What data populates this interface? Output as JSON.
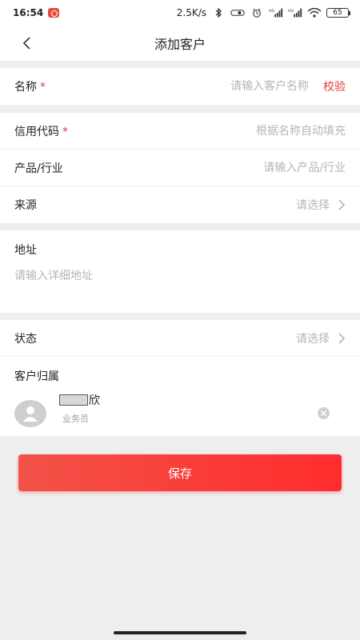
{
  "status_bar": {
    "time": "16:54",
    "network_speed": "2.5K/s",
    "battery": "65",
    "icons": [
      "app-notification-icon",
      "bluetooth-icon",
      "link-icon",
      "alarm-icon",
      "signal-hd-icon",
      "signal-hd-icon",
      "wifi-icon",
      "battery-icon"
    ]
  },
  "nav": {
    "title": "添加客户",
    "back_icon": "back-chevron-icon"
  },
  "form": {
    "name": {
      "label": "名称",
      "required_mark": "*",
      "placeholder": "请输入客户名称",
      "verify_label": "校验"
    },
    "credit_code": {
      "label": "信用代码",
      "required_mark": "*",
      "placeholder": "根据名称自动填充"
    },
    "industry": {
      "label": "产品/行业",
      "placeholder": "请输入产品/行业"
    },
    "source": {
      "label": "来源",
      "value": "请选择"
    },
    "address": {
      "label": "地址",
      "placeholder": "请输入详细地址"
    },
    "status": {
      "label": "状态",
      "value": "请选择"
    },
    "owner": {
      "title": "客户归属",
      "user_name_suffix": "欣",
      "user_role": "业务员"
    }
  },
  "actions": {
    "save_label": "保存"
  },
  "colors": {
    "accent": "#e53935",
    "button_gradient_start": "#f25248",
    "button_gradient_end": "#ff2d2d",
    "page_background": "#eeeeee",
    "placeholder": "#b5b5b5"
  }
}
